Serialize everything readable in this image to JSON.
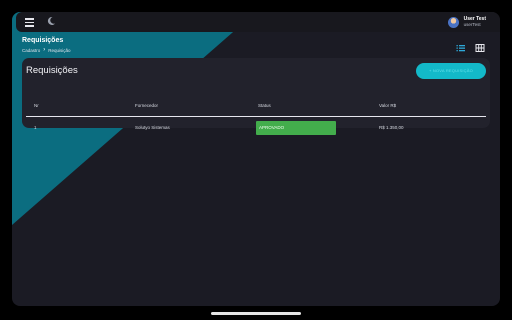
{
  "user": {
    "name": "User Test",
    "login": "userTest"
  },
  "page": {
    "title": "Requisições",
    "breadcrumb": [
      "Cadastro",
      "Requisição"
    ]
  },
  "card": {
    "title": "Requisições",
    "new_button_label": "+ NOVA REQUISIÇÃO"
  },
  "table": {
    "columns": [
      "Nr",
      "Fornecedor",
      "Status",
      "Valor R$"
    ],
    "rows": [
      {
        "nr": "1",
        "fornecedor": "Solutyo Sistemas",
        "status": "APROVADO",
        "valor": "R$ 1.350,00"
      }
    ]
  },
  "icons": [
    "menu-icon",
    "moon-icon",
    "avatar",
    "list-view-icon",
    "grid-view-icon",
    "chevron-right-icon"
  ],
  "colors": {
    "accent_teal": "#0b6d80",
    "button_teal": "#13b9c9",
    "active_icon": "#2ea8d8",
    "status_approved": "#43ad4c",
    "background": "#1b1b24",
    "card": "#22222c"
  }
}
